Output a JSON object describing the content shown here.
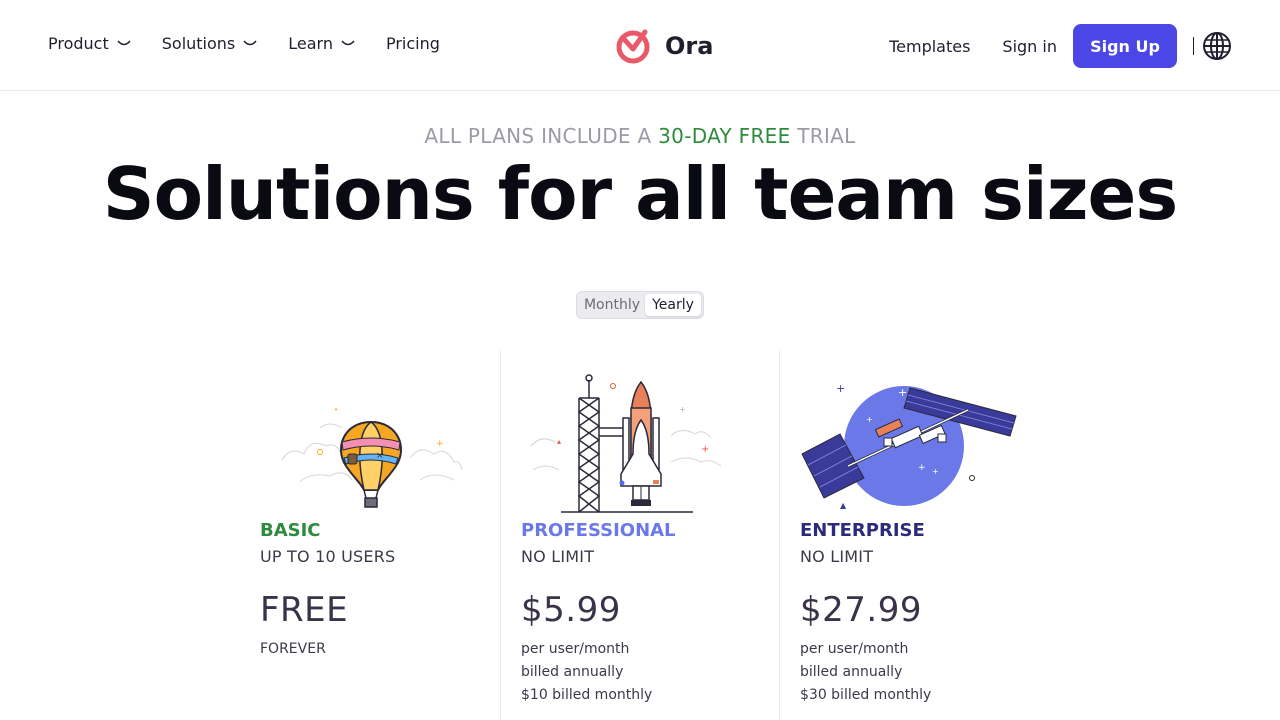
{
  "header": {
    "nav": [
      {
        "label": "Product",
        "dropdown": true
      },
      {
        "label": "Solutions",
        "dropdown": true
      },
      {
        "label": "Learn",
        "dropdown": true
      },
      {
        "label": "Pricing",
        "dropdown": false
      }
    ],
    "logo_text": "Ora",
    "templates_label": "Templates",
    "signin_label": "Sign in",
    "signup_label": "Sign Up",
    "separator": "|",
    "brand_color": "#4b47e6"
  },
  "hero": {
    "trial_prefix": "ALL PLANS INCLUDE A",
    "trial_highlight": "30-DAY FREE",
    "trial_suffix": "TRIAL",
    "title": "Solutions for all team sizes"
  },
  "billing_toggle": {
    "monthly_label": "Monthly",
    "yearly_label": "Yearly",
    "selected": "Yearly"
  },
  "plans": [
    {
      "name": "BASIC",
      "users": "UP TO 10 USERS",
      "price": "FREE",
      "notes": [
        "FOREVER"
      ],
      "color": "#2e8b3d",
      "icon": "hot-air-balloon"
    },
    {
      "name": "PROFESSIONAL",
      "users": "NO LIMIT",
      "price": "$5.99",
      "notes": [
        "per user/month",
        "billed annually",
        "$10 billed monthly"
      ],
      "color": "#6b79e8",
      "icon": "space-shuttle"
    },
    {
      "name": "ENTERPRISE",
      "users": "NO LIMIT",
      "price": "$27.99",
      "notes": [
        "per user/month",
        "billed annually",
        "$30 billed monthly"
      ],
      "color": "#2e2a7a",
      "icon": "space-station"
    }
  ]
}
